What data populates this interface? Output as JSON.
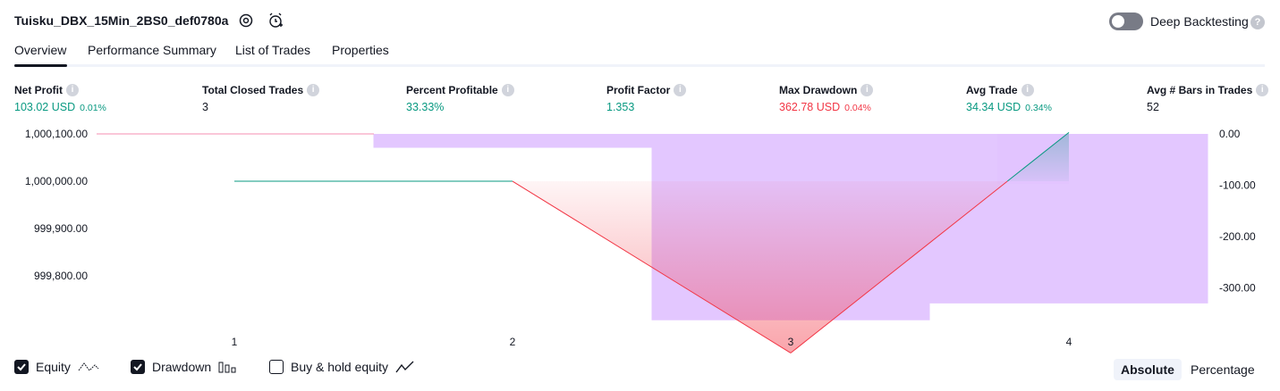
{
  "header": {
    "strategy_name": "Tuisku_DBX_15Min_2BS0_def0780a",
    "settings_icon": "gear-icon",
    "alert_icon": "alarm-clock-icon",
    "deep_backtesting_label": "Deep Backtesting",
    "deep_backtesting_enabled": false
  },
  "tabs": [
    {
      "label": "Overview",
      "active": true
    },
    {
      "label": "Performance Summary",
      "active": false
    },
    {
      "label": "List of Trades",
      "active": false
    },
    {
      "label": "Properties",
      "active": false
    }
  ],
  "metrics": [
    {
      "label": "Net Profit",
      "value": "103.02 USD",
      "pct": "0.01%",
      "color": "#089981"
    },
    {
      "label": "Total Closed Trades",
      "value": "3",
      "pct": "",
      "color": "#131722"
    },
    {
      "label": "Percent Profitable",
      "value": "33.33%",
      "pct": "",
      "color": "#089981"
    },
    {
      "label": "Profit Factor",
      "value": "1.353",
      "pct": "",
      "color": "#089981"
    },
    {
      "label": "Max Drawdown",
      "value": "362.78 USD",
      "pct": "0.04%",
      "color": "#f23645"
    },
    {
      "label": "Avg Trade",
      "value": "34.34 USD",
      "pct": "0.34%",
      "color": "#089981"
    },
    {
      "label": "Avg # Bars in Trades",
      "value": "52",
      "pct": "",
      "color": "#131722"
    }
  ],
  "chart_data": {
    "type": "line",
    "x": [
      1,
      2,
      3,
      4
    ],
    "left_axis": {
      "ticks": [
        "1,000,100.00",
        "1,000,000.00",
        "999,900.00",
        "999,800.00"
      ],
      "tick_values": [
        1000100,
        1000000,
        999900,
        999800
      ],
      "ylim": [
        999704,
        1000100
      ]
    },
    "right_axis": {
      "ticks": [
        "0.00",
        "-100.00",
        "-200.00",
        "-300.00"
      ],
      "tick_values": [
        0,
        -100,
        -200,
        -300
      ],
      "ylim": [
        -365,
        0
      ]
    },
    "series": [
      {
        "name": "Equity",
        "values": [
          1000000,
          1000000,
          999637.22,
          1000103.02
        ]
      },
      {
        "name": "Buy & hold equity",
        "values": [
          1000100,
          1000100,
          1000100,
          1000100
        ]
      }
    ],
    "drawdown_bars": [
      {
        "x_from": 1.5,
        "x_to": 2.5,
        "value": -27
      },
      {
        "x_from": 2.5,
        "x_to": 3.5,
        "value": -362.78
      },
      {
        "x_from": 3.5,
        "x_to": 4.5,
        "value": -330
      },
      {
        "x_from": 4.0,
        "x_to": 4.0,
        "value": -97
      }
    ],
    "colors": {
      "profit": "#089981",
      "loss": "#f23645",
      "drawdown": "#e1c4ff",
      "buyhold": "#f48fb1"
    }
  },
  "legend": [
    {
      "label": "Equity",
      "checked": true,
      "icon": "equity-line-icon"
    },
    {
      "label": "Drawdown",
      "checked": true,
      "icon": "drawdown-bars-icon"
    },
    {
      "label": "Buy & hold equity",
      "checked": false,
      "icon": "buyhold-line-icon"
    }
  ],
  "view_mode": {
    "options": [
      "Absolute",
      "Percentage"
    ],
    "selected": "Absolute"
  }
}
